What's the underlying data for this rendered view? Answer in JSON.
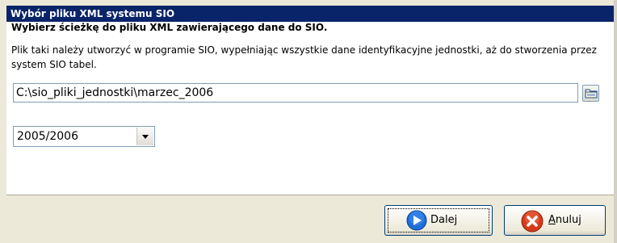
{
  "window": {
    "title": "Wybór pliku XML systemu SIO"
  },
  "main": {
    "heading": "Wybierz ścieżkę do pliku XML zawierającego dane do SIO.",
    "description": "Plik taki należy utworzyć w programie SIO, wypełniając wszystkie dane identyfikacyjne jednostki, aż do stworzenia przez system SIO tabel.",
    "path_value": "C:\\sio_pliki_jednostki\\marzec_2006",
    "year_selected": "2005/2006"
  },
  "footer": {
    "next_label": "Dalej",
    "cancel_label_first": "A",
    "cancel_label_rest": "nuluj"
  },
  "icons": {
    "browse": "folder-icon",
    "next": "arrow-right-icon",
    "cancel": "cancel-x-icon",
    "dropdown": "chevron-down-icon"
  },
  "colors": {
    "titlebar": "#0a246a",
    "panel": "#ffffff",
    "footer": "#ece9d8",
    "next_icon": "#1e6fd9",
    "cancel_icon": "#d63a1a"
  }
}
